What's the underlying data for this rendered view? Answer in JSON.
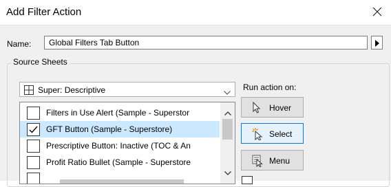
{
  "window": {
    "title": "Add Filter Action"
  },
  "name_field": {
    "label": "Name:",
    "value": "Global Filters Tab Button"
  },
  "source_sheets": {
    "group_title": "Source Sheets",
    "data_source": "Super: Descriptive",
    "items": [
      {
        "label": "Filters in Use Alert (Sample - Superstor",
        "checked": false,
        "selected": false
      },
      {
        "label": "GFT Button (Sample - Superstore)",
        "checked": true,
        "selected": true
      },
      {
        "label": "Prescriptive Button: Inactive (TOC & An",
        "checked": false,
        "selected": false
      },
      {
        "label": "Profit Ratio Bullet (Sample - Superstore",
        "checked": false,
        "selected": false
      }
    ]
  },
  "run_action": {
    "label": "Run action on:",
    "options": [
      {
        "label": "Hover",
        "icon": "hover-cursor-icon",
        "active": false
      },
      {
        "label": "Select",
        "icon": "select-cursor-icon",
        "active": true
      },
      {
        "label": "Menu",
        "icon": "menu-cursor-icon",
        "active": false
      }
    ]
  },
  "colors": {
    "selection": "#cce8ff",
    "active_border": "#0078d7",
    "dialog_bg": "#f0f0f0"
  }
}
